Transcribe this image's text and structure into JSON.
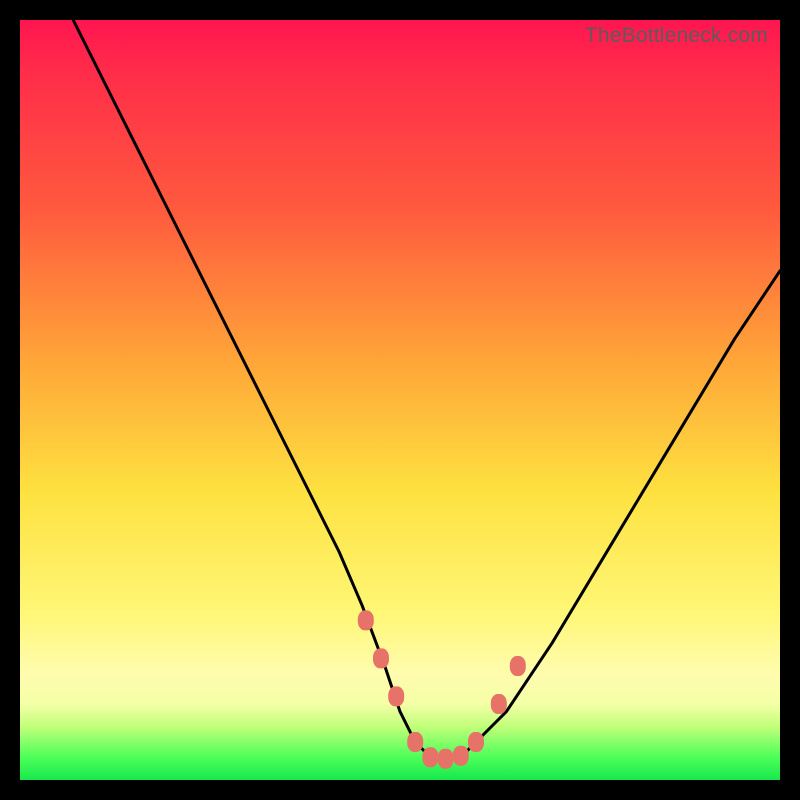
{
  "watermark": "TheBottleneck.com",
  "colors": {
    "frame": "#000000",
    "curve": "#000000",
    "marker_fill": "#e77268",
    "gradient_stops": [
      "#ff1550",
      "#ff5a3e",
      "#ffa638",
      "#fde140",
      "#fffcae",
      "#17e84e"
    ]
  },
  "chart_data": {
    "type": "line",
    "title": "",
    "xlabel": "",
    "ylabel": "",
    "xlim": [
      0,
      100
    ],
    "ylim": [
      0,
      100
    ],
    "grid": false,
    "legend": false,
    "series": [
      {
        "name": "bottleneck-curve",
        "x": [
          7,
          12,
          17,
          22,
          27,
          32,
          37,
          42,
          45,
          48,
          50,
          52,
          54,
          56,
          58,
          60,
          64,
          70,
          76,
          82,
          88,
          94,
          100
        ],
        "y": [
          100,
          90,
          80,
          70,
          60,
          50,
          40,
          30,
          23,
          15,
          9,
          5,
          3,
          2.5,
          3,
          5,
          9,
          18,
          28,
          38,
          48,
          58,
          67
        ],
        "note": "Inferred from pixel shape; values approximate to nearest integer."
      }
    ],
    "markers": {
      "name": "highlight-points",
      "x": [
        45.5,
        47.5,
        49.5,
        52,
        54,
        56,
        58,
        60,
        63,
        65.5
      ],
      "y": [
        21,
        16,
        11,
        5,
        3,
        2.8,
        3.2,
        5,
        10,
        15
      ]
    }
  }
}
